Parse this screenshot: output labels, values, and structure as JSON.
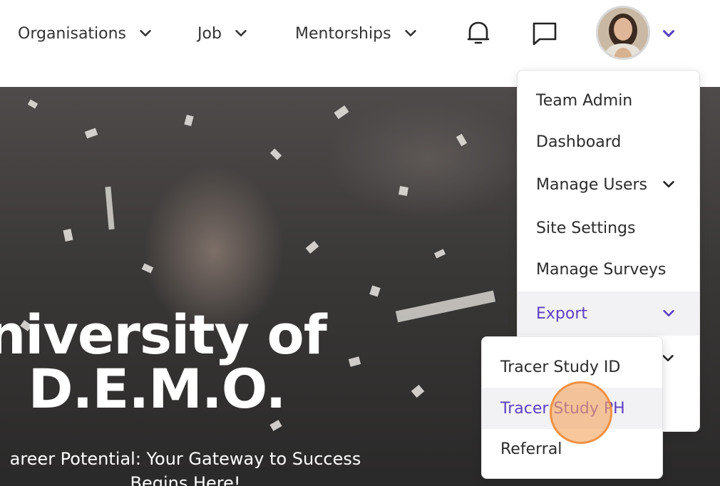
{
  "nav": {
    "items": [
      {
        "label": "Organisations"
      },
      {
        "label": "Job"
      },
      {
        "label": "Mentorships"
      }
    ],
    "icons": {
      "notifications": "bell-icon",
      "messages": "chat-icon",
      "profile_menu": "chevron-down-icon"
    },
    "accent_color": "#5b3fc4"
  },
  "hero": {
    "title_line1": "niversity of",
    "title_line2": "D.E.M.O.",
    "subtitle_line1": "areer Potential: Your Gateway to Success",
    "subtitle_line2": "Begins Here!"
  },
  "user_menu": {
    "items": [
      {
        "label": "Team Admin"
      },
      {
        "label": "Dashboard"
      },
      {
        "label": "Manage Users"
      },
      {
        "label": "Site Settings"
      },
      {
        "label": "Manage Surveys"
      },
      {
        "label": "Export"
      }
    ]
  },
  "export_menu": {
    "items": [
      {
        "label": "Tracer Study ID"
      },
      {
        "label": "Tracer Study PH"
      },
      {
        "label": "Referral"
      }
    ]
  }
}
